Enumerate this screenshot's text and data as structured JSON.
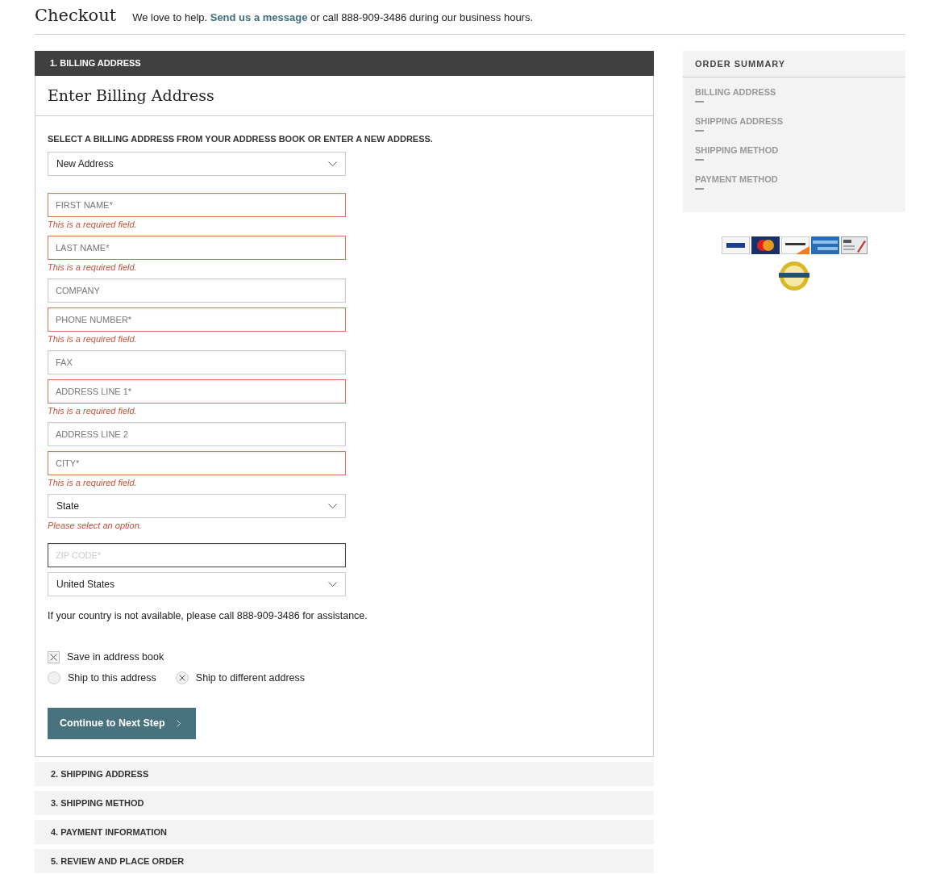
{
  "header": {
    "title": "Checkout",
    "help": "We love to help. ",
    "link": "Send us a message",
    "help_after": " or call 888-909-3486 during our business hours."
  },
  "steps": [
    {
      "label": "1. BILLING ADDRESS",
      "expanded": true
    },
    {
      "label": "2. SHIPPING ADDRESS",
      "expanded": false
    },
    {
      "label": "3. SHIPPING METHOD",
      "expanded": false
    },
    {
      "label": "4. PAYMENT INFORMATION",
      "expanded": false
    },
    {
      "label": "5. REVIEW AND PLACE ORDER",
      "expanded": false
    }
  ],
  "billing": {
    "title": "Enter Billing Address",
    "prompt": "SELECT A BILLING ADDRESS FROM YOUR ADDRESS BOOK OR ENTER A NEW ADDRESS.",
    "address_select": "New Address",
    "fields": [
      {
        "kind": "input",
        "placeholder": "FIRST NAME*",
        "invalid": true,
        "error": "This is a required field."
      },
      {
        "kind": "input",
        "placeholder": "LAST NAME*",
        "invalid": true,
        "error": "This is a required field."
      },
      {
        "kind": "input",
        "placeholder": "COMPANY",
        "invalid": false
      },
      {
        "kind": "input",
        "placeholder": "PHONE NUMBER*",
        "invalid": true,
        "error": "This is a required field."
      },
      {
        "kind": "input",
        "placeholder": "FAX",
        "invalid": false
      },
      {
        "kind": "input",
        "placeholder": "ADDRESS LINE 1*",
        "invalid": true,
        "error": "This is a required field."
      },
      {
        "kind": "input",
        "placeholder": "ADDRESS LINE 2",
        "invalid": false
      },
      {
        "kind": "input",
        "placeholder": "CITY*",
        "invalid": true,
        "error": "This is a required field."
      },
      {
        "kind": "select",
        "value": "State",
        "invalid": false,
        "error": "Please select an option."
      },
      {
        "kind": "input",
        "placeholder": "ZIP CODE*",
        "invalid": false,
        "focused": true
      },
      {
        "kind": "select",
        "value": "United States",
        "invalid": false
      }
    ],
    "note": "If your country is not available, please call 888-909-3486 for assistance.",
    "save": {
      "label": "Save in address book",
      "checked": true
    },
    "ship_options": [
      {
        "label": "Ship to this address",
        "selected": false
      },
      {
        "label": "Ship to different address",
        "selected": true
      }
    ],
    "button": "Continue to Next Step"
  },
  "summary": {
    "title": "ORDER SUMMARY",
    "items": [
      "BILLING ADDRESS",
      "SHIPPING ADDRESS",
      "SHIPPING METHOD",
      "PAYMENT METHOD"
    ]
  }
}
